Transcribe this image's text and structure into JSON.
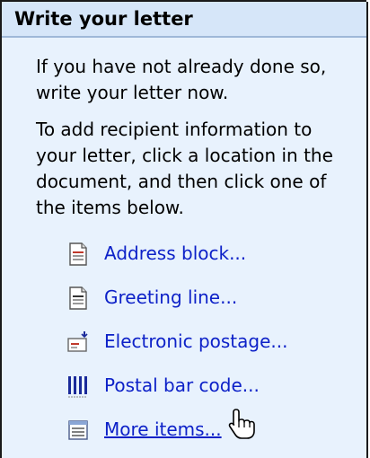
{
  "pane": {
    "title": "Write your letter",
    "paragraph1": "If you have not already done so, write your letter now.",
    "paragraph2": "To add recipient information to your letter, click a location in the document, and then click one of the items below."
  },
  "items": [
    {
      "label": "Address block...",
      "icon": "document-icon"
    },
    {
      "label": "Greeting line...",
      "icon": "document-icon"
    },
    {
      "label": "Electronic postage...",
      "icon": "postage-icon"
    },
    {
      "label": "Postal bar code...",
      "icon": "barcode-icon"
    },
    {
      "label": "More items...",
      "icon": "list-icon"
    }
  ],
  "colors": {
    "link": "#0d21c8",
    "pane_background": "#e8f2fd",
    "header_background": "#d6e6f9"
  },
  "cursor": "hand-pointer-icon"
}
